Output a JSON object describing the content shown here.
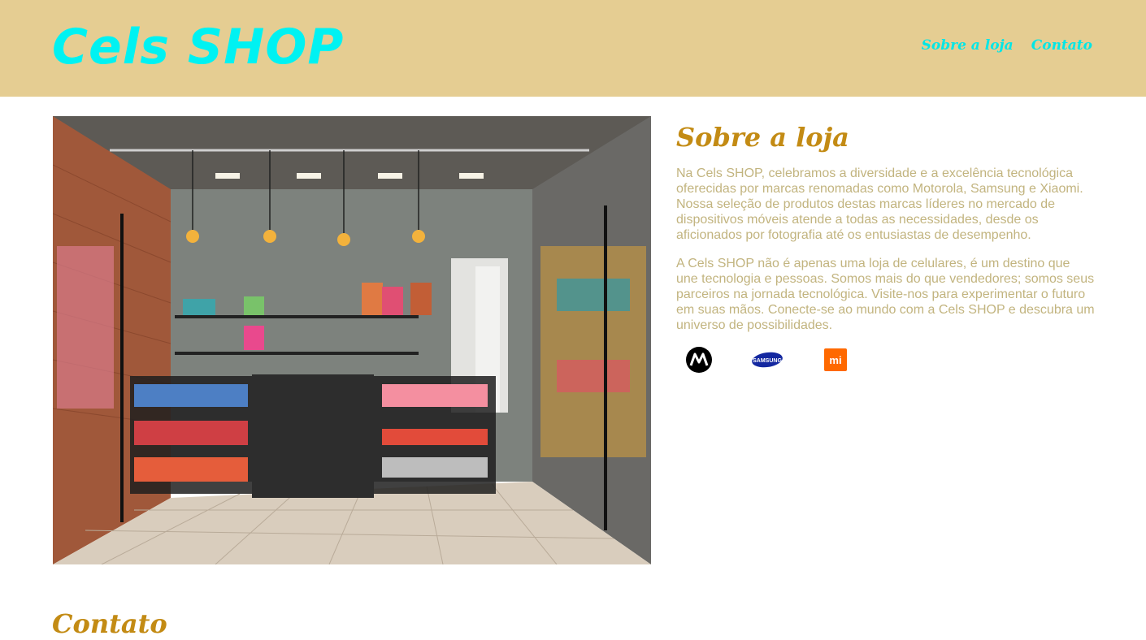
{
  "header": {
    "logo": "Cels SHOP",
    "nav": [
      {
        "label": "Sobre a loja"
      },
      {
        "label": "Contato"
      }
    ]
  },
  "about": {
    "title": "Sobre a loja",
    "paragraphs": [
      "Na Cels SHOP, celebramos a diversidade e a excelência tecnológica oferecidas por marcas renomadas como Motorola, Samsung e Xiaomi. Nossa seleção de produtos destas marcas líderes no mercado de dispositivos móveis atende a todas as necessidades, desde os aficionados por fotografia até os entusiastas de desempenho.",
      "A Cels SHOP não é apenas uma loja de celulares, é um destino que une tecnologia e pessoas. Somos mais do que vendedores; somos seus parceiros na jornada tecnológica. Visite-nos para experimentar o futuro em suas mãos. Conecte-se ao mundo com a Cels SHOP e descubra um universo de possibilidades."
    ],
    "brands": [
      {
        "icon": "motorola-logo-icon"
      },
      {
        "icon": "samsung-logo-icon",
        "text": "SAMSUNG"
      },
      {
        "icon": "xiaomi-logo-icon",
        "text": "mi"
      }
    ]
  },
  "contact": {
    "title": "Contato"
  },
  "colors": {
    "header_bg": "#e5cd92",
    "logo": "#00f2f2",
    "heading": "#c38b14",
    "body_text": "#c2b47f"
  }
}
